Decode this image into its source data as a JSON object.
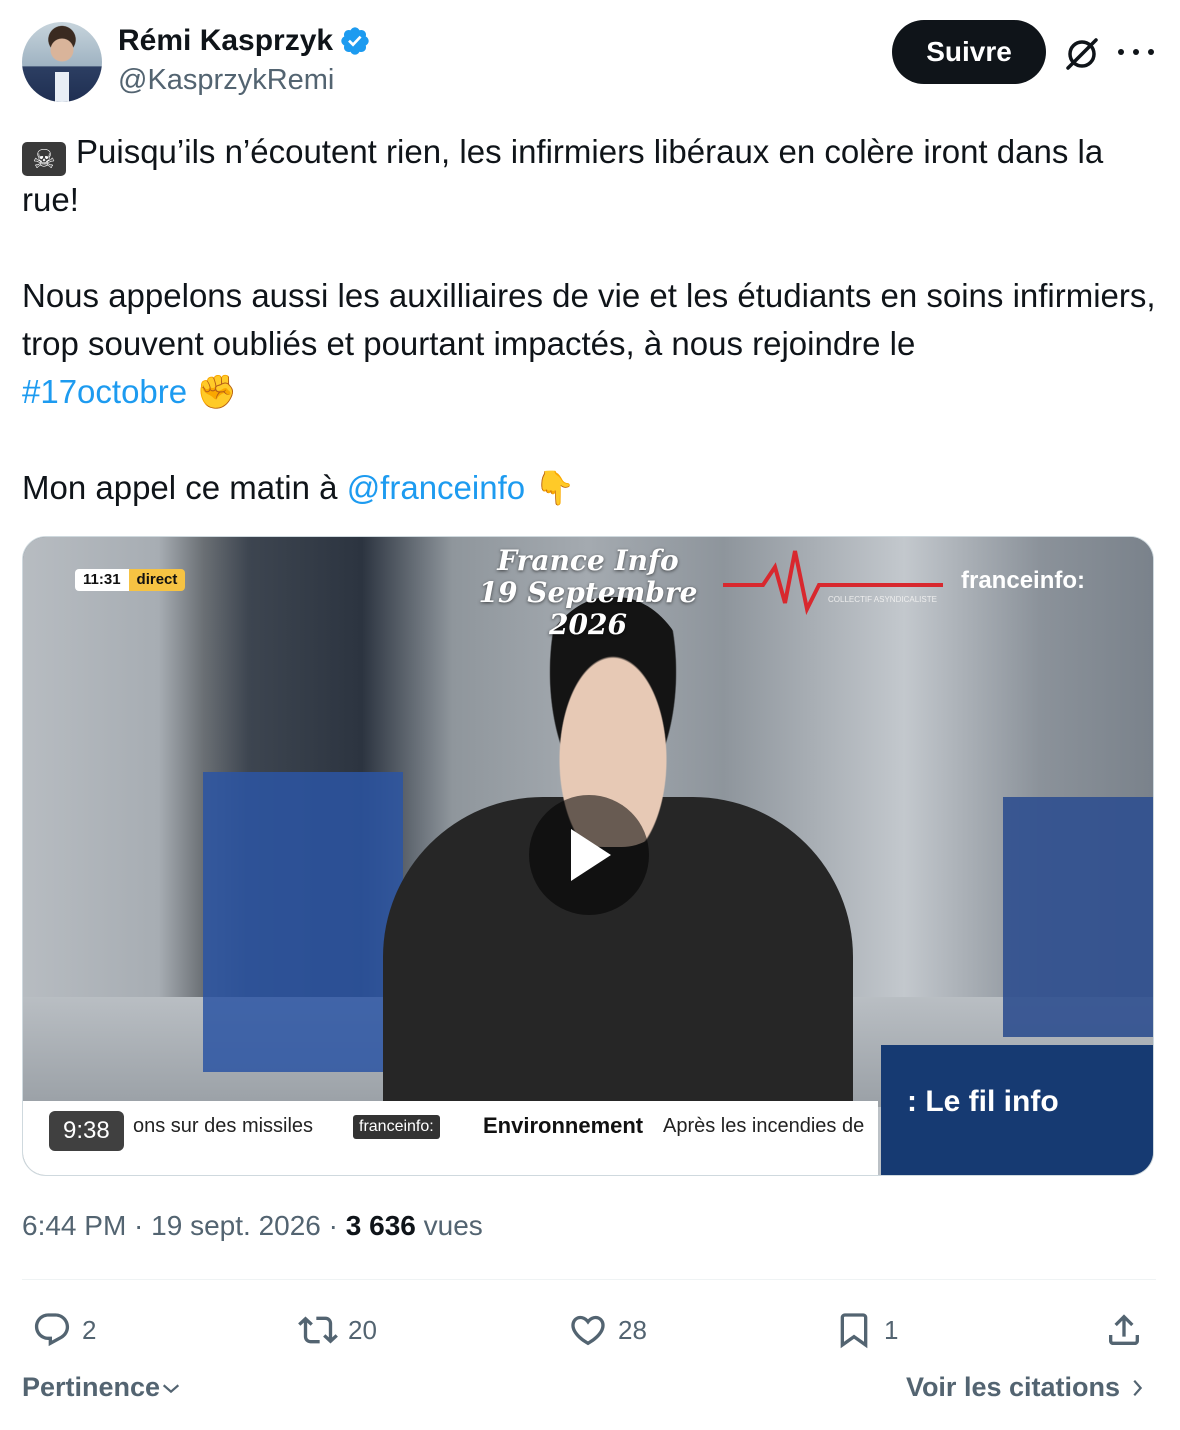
{
  "author": {
    "name": "Rémi Kasprzyk",
    "handle": "@KasprzykRemi",
    "verified_color": "#1d9bf0",
    "avatar_icon": "avatar-photo"
  },
  "header": {
    "follow_label": "Suivre",
    "grok_icon": "grok-icon",
    "more_icon": "more-icon"
  },
  "tweet": {
    "skull_emoji": "☠",
    "line1": "Puisqu’ils n’écoutent rien, les infirmiers libéraux en colère iront dans la rue!",
    "line2": "Nous appelons aussi les auxilliaires de vie et les étudiants en soins infirmiers, trop souvent oubliés et pourtant impactés, à nous rejoindre le",
    "hashtag": "#17octobre",
    "fist_emoji": "✊",
    "line3": "Mon appel ce matin à",
    "mention": "@franceinfo",
    "point_emoji": "👇"
  },
  "video": {
    "clock": "11:31",
    "live_label": "direct",
    "overlay_line1": "France Info",
    "overlay_line2": "19 Septembre 2026",
    "ecg_caption": "COLLECTIF ASYNDICALISTE",
    "channel": "franceinfo:",
    "ticker_text": "ons sur des missiles",
    "ticker_logo": "franceinfo:",
    "ticker_bold": "Environnement",
    "ticker_rest": "Après les incendies de",
    "fil_info": ": Le fil info",
    "duration": "9:38",
    "play_icon": "play-icon"
  },
  "meta": {
    "time": "6:44 PM",
    "separator": " · ",
    "date": "19 sept. 2026",
    "views": "3 636",
    "views_label": "vues"
  },
  "actions": {
    "replies": "2",
    "reposts": "20",
    "likes": "28",
    "bookmarks": "1"
  },
  "footer": {
    "sort_label": "Pertinence",
    "quotes_label": "Voir les citations"
  }
}
